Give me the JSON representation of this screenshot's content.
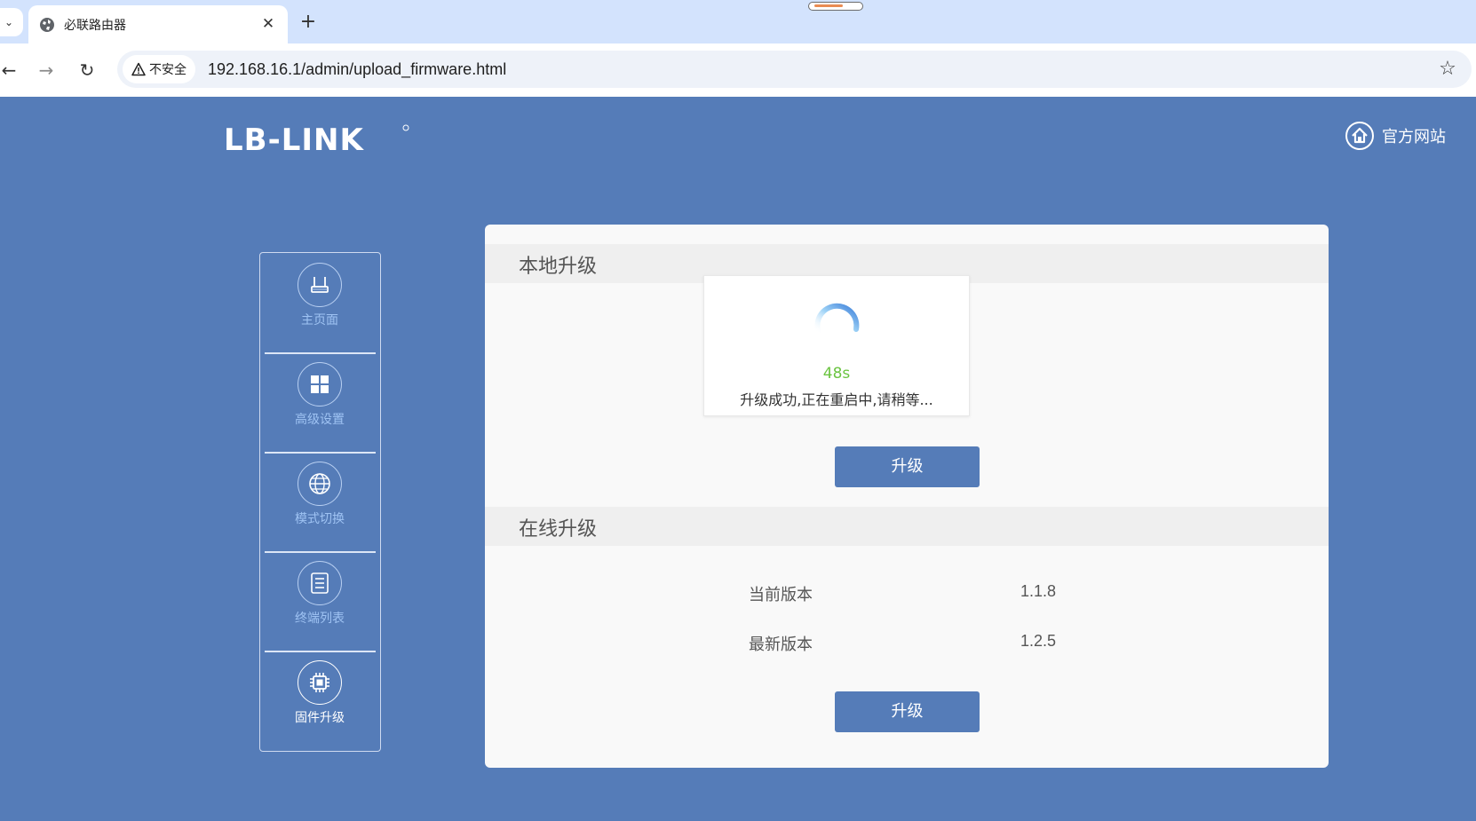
{
  "browser": {
    "tab": {
      "title": "必联路由器",
      "close_glyph": "✕"
    },
    "new_tab_glyph": "+",
    "dropdown_glyph": "⌄",
    "nav": {
      "back_glyph": "←",
      "forward_glyph": "→",
      "reload_glyph": "↻"
    },
    "security_label": "不安全",
    "url": "192.168.16.1/admin/upload_firmware.html",
    "bookmark_glyph": "☆"
  },
  "header": {
    "logo_text": "LB-LINK",
    "official_site_label": "官方网站"
  },
  "sidebar": {
    "items": [
      {
        "label": "主页面",
        "icon": "router-icon",
        "active": false
      },
      {
        "label": "高级设置",
        "icon": "grid-icon",
        "active": false
      },
      {
        "label": "模式切换",
        "icon": "globe-icon",
        "active": false
      },
      {
        "label": "终端列表",
        "icon": "list-icon",
        "active": false
      },
      {
        "label": "固件升级",
        "icon": "chip-icon",
        "active": true
      }
    ]
  },
  "local_upgrade": {
    "title": "本地升级",
    "countdown": "48s",
    "status_message": "升级成功,正在重启中,请稍等...",
    "button_label": "升级"
  },
  "online_upgrade": {
    "title": "在线升级",
    "current_version_label": "当前版本",
    "current_version": "1.1.8",
    "latest_version_label": "最新版本",
    "latest_version": "1.2.5",
    "button_label": "升级"
  },
  "colors": {
    "page_bg": "#557cb8",
    "accent": "#557cb8",
    "success_green": "#6bc441",
    "sidebar_label": "#9fc3f3"
  }
}
